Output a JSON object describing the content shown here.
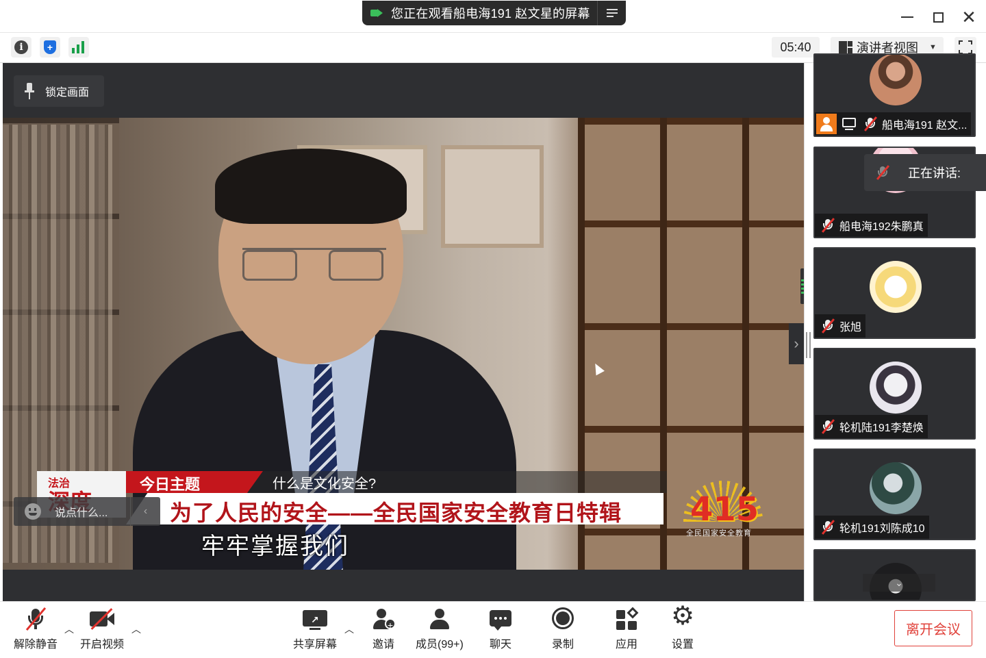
{
  "titlebar": {
    "share_notice": "您正在观看船电海191 赵文星的屏幕",
    "colors": {
      "accent_green": "#3bbf5b",
      "pill_bg": "#2b2b2b"
    }
  },
  "toolbar": {
    "timer": "05:40",
    "view_mode": "演讲者视图",
    "icons": [
      "info-icon",
      "shield-icon",
      "signal-bars-icon",
      "fullscreen-icon"
    ]
  },
  "stage": {
    "lock_label": "锁定画面",
    "video": {
      "topic_tag": "今日主题",
      "topic_question": "什么是文化安全?",
      "program_logo_small": "法治",
      "program_logo_big": "深度",
      "headline": "为了人民的安全——全民国家安全教育日特辑",
      "subtitle": "牢牢掌握我们",
      "badge_number": "415",
      "badge_sub": "全民国家安全教育"
    },
    "chat_placeholder": "说点什么...",
    "chat_collapse": "‹",
    "side_arrow": "›"
  },
  "participants": [
    {
      "name": "船电海191 赵文...",
      "host": true,
      "sharing": true,
      "muted": true
    },
    {
      "name": "船电海192朱鹏真",
      "muted": true
    },
    {
      "name": "张旭",
      "muted": true
    },
    {
      "name": "轮机陆191李楚焕",
      "muted": true
    },
    {
      "name": "轮机191刘陈成10",
      "muted": true
    },
    {
      "name": "",
      "muted": true
    }
  ],
  "speaking_label": "正在讲话:",
  "bottombar": {
    "unmute": "解除静音",
    "start_video": "开启视频",
    "share_screen": "共享屏幕",
    "invite": "邀请",
    "members": "成员(99+)",
    "chat": "聊天",
    "record": "录制",
    "apps": "应用",
    "settings": "设置",
    "leave": "离开会议",
    "colors": {
      "leave_red": "#e0413a",
      "mute_red": "#e0322d"
    }
  }
}
